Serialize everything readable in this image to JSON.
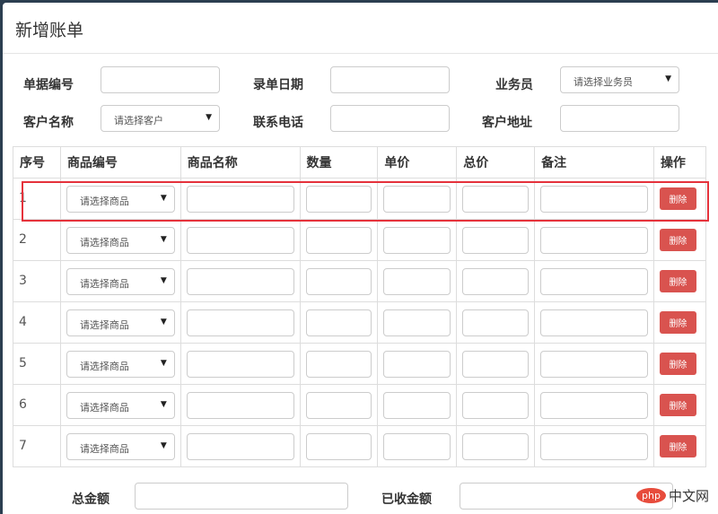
{
  "title": "新增账单",
  "form": {
    "bill_no": "单据编号",
    "entry_date": "录单日期",
    "salesman": "业务员",
    "salesman_placeholder": "请选择业务员",
    "customer": "客户名称",
    "customer_placeholder": "请选择客户",
    "phone": "联系电话",
    "address": "客户地址"
  },
  "table": {
    "headers": [
      "序号",
      "商品编号",
      "商品名称",
      "数量",
      "单价",
      "总价",
      "备注",
      "操作"
    ],
    "product_placeholder": "请选择商品",
    "delete_label": "删除",
    "rows": [
      "1",
      "2",
      "3",
      "4",
      "5",
      "6",
      "7"
    ]
  },
  "footer": {
    "total": "总金额",
    "received": "已收金额"
  },
  "watermark": {
    "logo": "php",
    "text": "中文网"
  }
}
